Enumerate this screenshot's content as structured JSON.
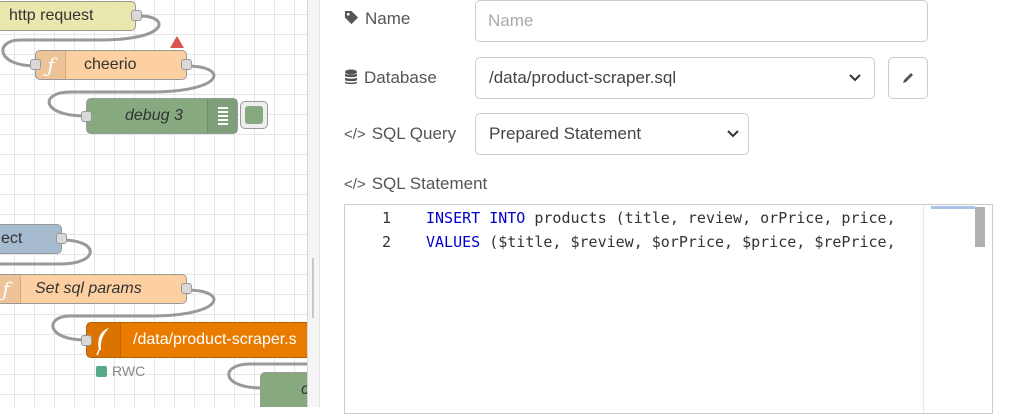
{
  "canvas": {
    "nodes": {
      "http_request": "http request",
      "cheerio": "cheerio",
      "debug3": "debug 3",
      "select": "ect",
      "set_sql_params": "Set sql params",
      "sqlite_node": "/data/product-scraper.s",
      "sqlite_status": "RWC",
      "partial_node": "c"
    },
    "colors": {
      "http_node": "#e7e7ae",
      "function_node": "#fdd0a2",
      "debug_node": "#87a980",
      "inject_node": "#a6bbcf",
      "sqlite_node": "#e97b00",
      "wire": "#999999",
      "status_green": "#5a8"
    }
  },
  "panel": {
    "name": {
      "label": "Name",
      "placeholder": "Name",
      "value": ""
    },
    "database": {
      "label": "Database",
      "value": "/data/product-scraper.sql"
    },
    "sql_query": {
      "label": "SQL Query",
      "value": "Prepared Statement"
    },
    "sql_statement": {
      "label": "SQL Statement",
      "lines": [
        {
          "num": "1",
          "kw1": "INSERT",
          "kw2": "INTO",
          "rest": " products (title, review, orPrice, price,"
        },
        {
          "num": "2",
          "kw1": "VALUES",
          "kw2": "",
          "rest": " ($title, $review, $orPrice, $price, $rePrice,"
        }
      ]
    },
    "icons": {
      "name": "tag-icon",
      "database": "database-icon",
      "sql_query": "code-icon",
      "sql_statement": "code-icon",
      "edit": "pencil-icon"
    }
  }
}
